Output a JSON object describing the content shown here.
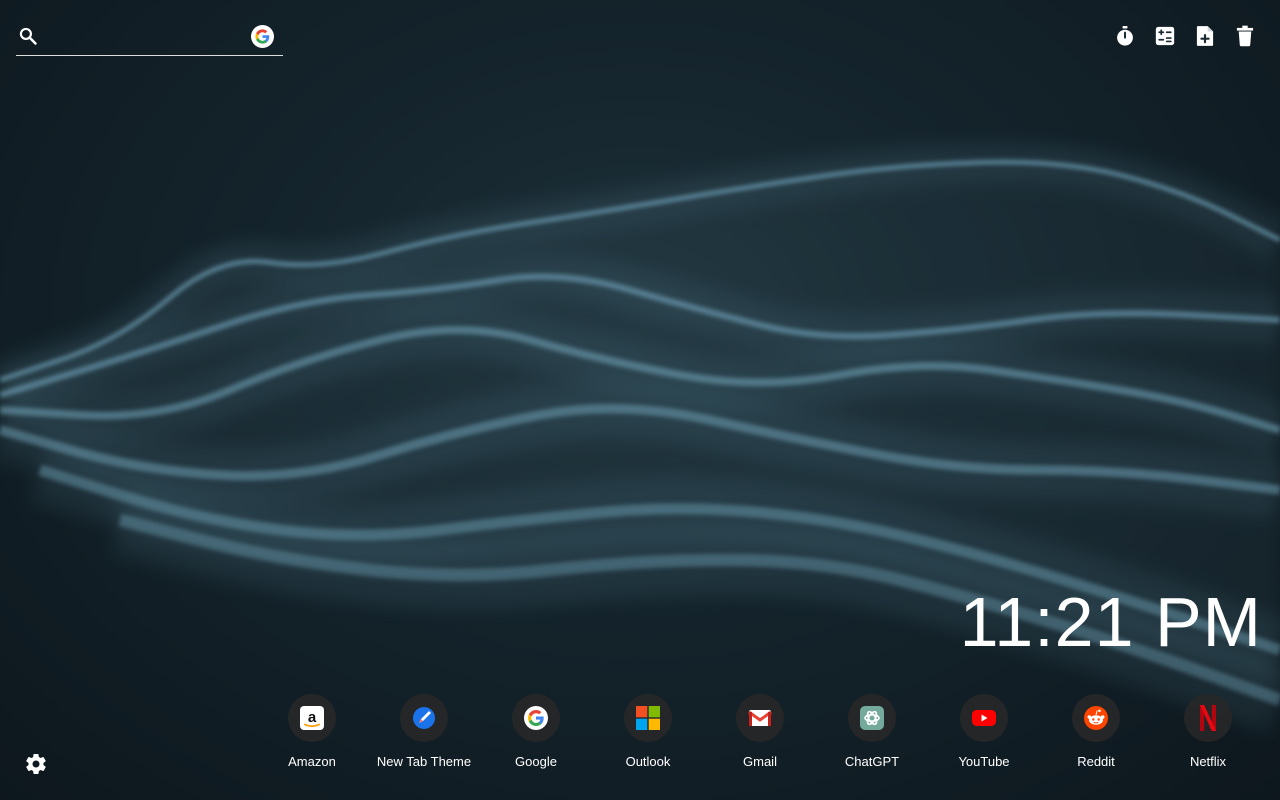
{
  "search": {
    "placeholder": "",
    "engine_icon": "google-icon"
  },
  "toolbar": {
    "items": [
      {
        "name": "timer-icon"
      },
      {
        "name": "calculator-icon"
      },
      {
        "name": "add-note-icon"
      },
      {
        "name": "trash-icon"
      }
    ]
  },
  "clock": {
    "time": "11:21 PM"
  },
  "shortcuts": [
    {
      "label": "Amazon",
      "icon": "amazon-icon"
    },
    {
      "label": "New Tab Theme",
      "icon": "new-tab-theme-icon"
    },
    {
      "label": "Google",
      "icon": "google-icon"
    },
    {
      "label": "Outlook",
      "icon": "microsoft-icon"
    },
    {
      "label": "Gmail",
      "icon": "gmail-icon"
    },
    {
      "label": "ChatGPT",
      "icon": "chatgpt-icon"
    },
    {
      "label": "YouTube",
      "icon": "youtube-icon"
    },
    {
      "label": "Reddit",
      "icon": "reddit-icon"
    },
    {
      "label": "Netflix",
      "icon": "netflix-icon"
    }
  ],
  "settings": {
    "icon": "gear-icon"
  },
  "colors": {
    "background": "#14232b",
    "particles": "#7fb6cf",
    "icon_circle": "#282828"
  }
}
